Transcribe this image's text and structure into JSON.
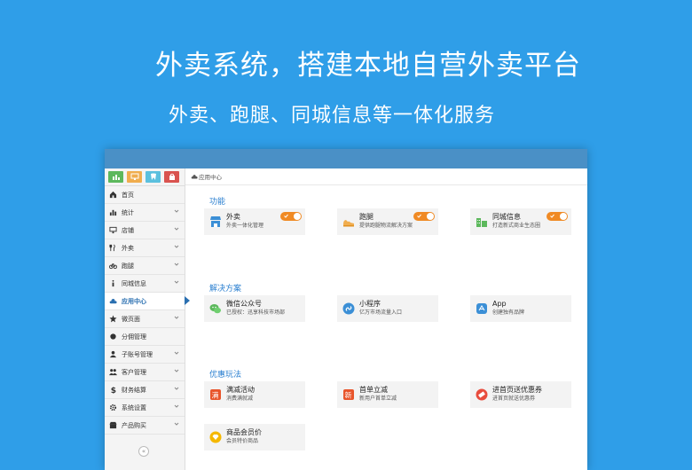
{
  "hero": {
    "title": "外卖系统，搭建本地自营外卖平台",
    "subtitle": "外卖、跑腿、同城信息等一体化服务"
  },
  "quick_buttons": [
    {
      "icon": "chart-icon",
      "color": "#5cb85c"
    },
    {
      "icon": "monitor-icon",
      "color": "#f0ad4e"
    },
    {
      "icon": "tooth-icon",
      "color": "#5bc0de"
    },
    {
      "icon": "bag-icon",
      "color": "#d9534f"
    }
  ],
  "sidebar": {
    "items": [
      {
        "label": "首页",
        "icon": "home-icon",
        "chevron": false
      },
      {
        "label": "统计",
        "icon": "bar-chart-icon",
        "chevron": true
      },
      {
        "label": "店铺",
        "icon": "monitor-icon",
        "chevron": true
      },
      {
        "label": "外卖",
        "icon": "cutlery-icon",
        "chevron": true
      },
      {
        "label": "跑腿",
        "icon": "bicycle-icon",
        "chevron": true
      },
      {
        "label": "同城信息",
        "icon": "info-icon",
        "chevron": true
      },
      {
        "label": "应用中心",
        "icon": "cloud-icon",
        "chevron": false,
        "active": true
      },
      {
        "label": "微页面",
        "icon": "star-icon",
        "chevron": true
      },
      {
        "label": "分佣管理",
        "icon": "circle-icon",
        "chevron": false
      },
      {
        "label": "子账号管理",
        "icon": "user-icon",
        "chevron": true
      },
      {
        "label": "客户管理",
        "icon": "users-icon",
        "chevron": true
      },
      {
        "label": "财务结算",
        "icon": "dollar-icon",
        "chevron": true
      },
      {
        "label": "系统设置",
        "icon": "gear-icon",
        "chevron": true
      },
      {
        "label": "产品购买",
        "icon": "shop-icon",
        "chevron": true
      }
    ],
    "collapse_glyph": "«"
  },
  "breadcrumb": "应用中心",
  "sections": [
    {
      "title": "功能",
      "cards": [
        {
          "name": "外卖",
          "desc": "外卖一体化管理",
          "icon": "store-icon",
          "toggle": true
        },
        {
          "name": "跑腿",
          "desc": "提供跑腿物流解决方案",
          "icon": "running-shoe-icon",
          "toggle": true
        },
        {
          "name": "同城信息",
          "desc": "打造新式商业生态圈",
          "icon": "city-icon",
          "toggle": true
        }
      ]
    },
    {
      "title": "解决方案",
      "cards": [
        {
          "name": "微信公众号",
          "desc": "已授权：迅享科技市场部",
          "icon": "wechat-icon",
          "toggle": false
        },
        {
          "name": "小程序",
          "desc": "亿万市场流量入口",
          "icon": "mini-program-icon",
          "toggle": false
        },
        {
          "name": "App",
          "desc": "创建独有品牌",
          "icon": "app-icon",
          "toggle": false
        }
      ]
    },
    {
      "title": "优惠玩法",
      "cards": [
        {
          "name": "满减活动",
          "desc": "消费满就减",
          "icon": "full-reduction-icon",
          "icon_glyph": "满",
          "toggle": false
        },
        {
          "name": "首单立减",
          "desc": "新用户首单立减",
          "icon": "new-order-icon",
          "icon_glyph": "新",
          "toggle": false
        },
        {
          "name": "进首页送优惠券",
          "desc": "进首页就送优惠券",
          "icon": "coupon-icon",
          "toggle": false
        },
        {
          "name": "商品会员价",
          "desc": "会员特价商品",
          "icon": "member-price-icon",
          "toggle": false
        }
      ]
    }
  ],
  "colors": {
    "background": "#2f9ee8",
    "topbar": "#4a90c6",
    "accent": "#2a7fd0",
    "toggle": "#f08a24"
  }
}
